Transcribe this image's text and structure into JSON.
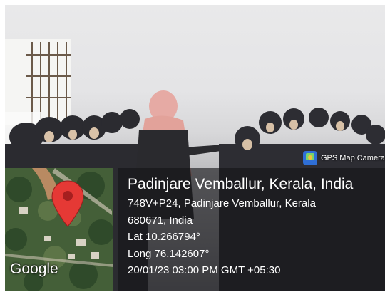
{
  "badge": {
    "label": "GPS Map Camera",
    "icon": "gps-map-camera-icon"
  },
  "location": {
    "title": "Padinjare Vemballur, Kerala, India",
    "address_line1": "748V+P24, Padinjare Vemballur, Kerala",
    "address_line2": "680671, India",
    "latitude": "Lat 10.266794°",
    "longitude": "Long 76.142607°",
    "timestamp": "20/01/23 03:00 PM GMT +05:30"
  },
  "map": {
    "logo": "Google",
    "pin_color": "#e53935"
  },
  "colors": {
    "overlay": "#141416",
    "text": "#ffffff"
  }
}
